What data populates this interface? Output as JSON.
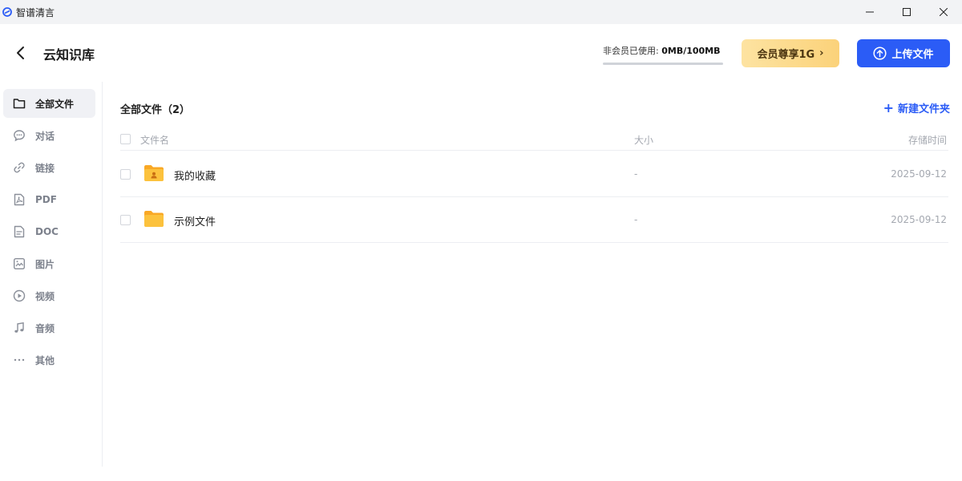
{
  "window": {
    "title": "智谱清言"
  },
  "header": {
    "title": "云知识库",
    "usage_label": "非会员已使用:",
    "usage_value": "0MB/100MB",
    "usage_progress": 0,
    "vip_button": "会员尊享1G",
    "upload_button": "上传文件"
  },
  "sidebar": {
    "items": [
      {
        "label": "全部文件",
        "icon": "folder-icon",
        "active": true
      },
      {
        "label": "对话",
        "icon": "chat-bubble-icon",
        "active": false
      },
      {
        "label": "链接",
        "icon": "link-icon",
        "active": false
      },
      {
        "label": "PDF",
        "icon": "pdf-file-icon",
        "active": false
      },
      {
        "label": "DOC",
        "icon": "doc-file-icon",
        "active": false
      },
      {
        "label": "图片",
        "icon": "image-icon",
        "active": false
      },
      {
        "label": "视频",
        "icon": "play-circle-icon",
        "active": false
      },
      {
        "label": "音频",
        "icon": "music-note-icon",
        "active": false
      },
      {
        "label": "其他",
        "icon": "more-dots-icon",
        "active": false
      }
    ]
  },
  "main": {
    "section_title": "全部文件（2）",
    "new_folder_button": "新建文件夹",
    "columns": {
      "name": "文件名",
      "size": "大小",
      "time": "存储时间"
    },
    "rows": [
      {
        "name": "我的收藏",
        "size": "-",
        "time": "2025-09-12",
        "icon": "favorites-folder-icon"
      },
      {
        "name": "示例文件",
        "size": "-",
        "time": "2025-09-12",
        "icon": "folder-icon"
      }
    ]
  },
  "colors": {
    "primary": "#2b5cf6",
    "vip_gradient_start": "#fde3a1",
    "vip_gradient_end": "#fbd27a",
    "folder": "#fbb72b"
  }
}
